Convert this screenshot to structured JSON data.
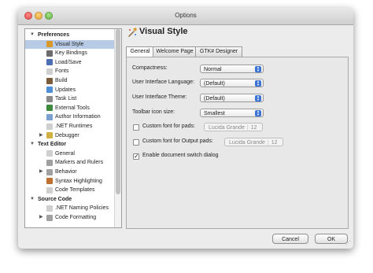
{
  "window": {
    "title": "Options"
  },
  "sidebar": {
    "rows": [
      {
        "label": "Preferences",
        "type": "category",
        "icon": "triangle-down",
        "top": 0
      },
      {
        "label": "Visual Style",
        "type": "item",
        "icon": "visual-style-icon",
        "color": "#d89a2a",
        "selected": true
      },
      {
        "label": "Key Bindings",
        "type": "item",
        "icon": "key-bindings-icon",
        "color": "#6c6c6c"
      },
      {
        "label": "Load/Save",
        "type": "item",
        "icon": "load-save-icon",
        "color": "#4a6fb5"
      },
      {
        "label": "Fonts",
        "type": "item",
        "icon": "fonts-icon",
        "color": "#cfcfcf"
      },
      {
        "label": "Build",
        "type": "item",
        "icon": "build-icon",
        "color": "#7a5b3a"
      },
      {
        "label": "Updates",
        "type": "item",
        "icon": "updates-icon",
        "color": "#4f8fd6"
      },
      {
        "label": "Task List",
        "type": "item",
        "icon": "task-list-icon",
        "color": "#8a8a8a"
      },
      {
        "label": "External Tools",
        "type": "item",
        "icon": "external-tools-icon",
        "color": "#3d8a3d"
      },
      {
        "label": "Author Information",
        "type": "item",
        "icon": "author-information-icon",
        "color": "#7aa0d0"
      },
      {
        "label": ".NET Runtimes",
        "type": "item",
        "icon": "net-runtimes-icon",
        "color": "#cfcfcf"
      },
      {
        "label": "Debugger",
        "type": "item-collapsed",
        "icon": "debugger-icon",
        "color": "#d0b040"
      },
      {
        "label": "Text Editor",
        "type": "category"
      },
      {
        "label": "General",
        "type": "item",
        "icon": "general-icon",
        "color": "#cfcfcf"
      },
      {
        "label": "Markers and Rulers",
        "type": "item",
        "icon": "markers-rulers-icon",
        "color": "#a0a0a0"
      },
      {
        "label": "Behavior",
        "type": "item-collapsed",
        "icon": "behavior-icon",
        "color": "#a0a0a0"
      },
      {
        "label": "Syntax Highlighting",
        "type": "item",
        "icon": "syntax-highlighting-icon",
        "color": "#c07030"
      },
      {
        "label": "Code Templates",
        "type": "item",
        "icon": "code-templates-icon",
        "color": "#cfcfcf"
      },
      {
        "label": "Source Code",
        "type": "category"
      },
      {
        "label": ".NET Naming Policies",
        "type": "item",
        "icon": "net-naming-policies-icon",
        "color": "#cfcfcf"
      },
      {
        "label": "Code Formatting",
        "type": "item-collapsed",
        "icon": "code-formatting-icon",
        "color": "#a0a0a0"
      }
    ]
  },
  "page": {
    "title": "Visual Style"
  },
  "tabs": [
    {
      "label": "General",
      "active": true
    },
    {
      "label": "Welcome Page",
      "active": false
    },
    {
      "label": "GTK# Designer",
      "active": false
    }
  ],
  "form": {
    "compactness": {
      "label": "Compactness:",
      "value": "Normal"
    },
    "ui_language": {
      "label": "User Interface Language:",
      "value": "(Default)"
    },
    "ui_theme": {
      "label": "User Interface Theme:",
      "value": "(Default)"
    },
    "toolbar_icon_size": {
      "label": "Toolbar icon size:",
      "value": "Smallest"
    },
    "custom_font_pads": {
      "label": "Custom font for pads:",
      "checked": false,
      "font_name": "Lucida Grande",
      "font_size": "12"
    },
    "custom_font_output": {
      "label": "Custom font for Output pads:",
      "checked": false,
      "font_name": "Lucida Grande",
      "font_size": "12"
    },
    "document_switch": {
      "label": "Enable document switch dialog",
      "checked": true
    }
  },
  "buttons": {
    "cancel": "Cancel",
    "ok": "OK"
  }
}
